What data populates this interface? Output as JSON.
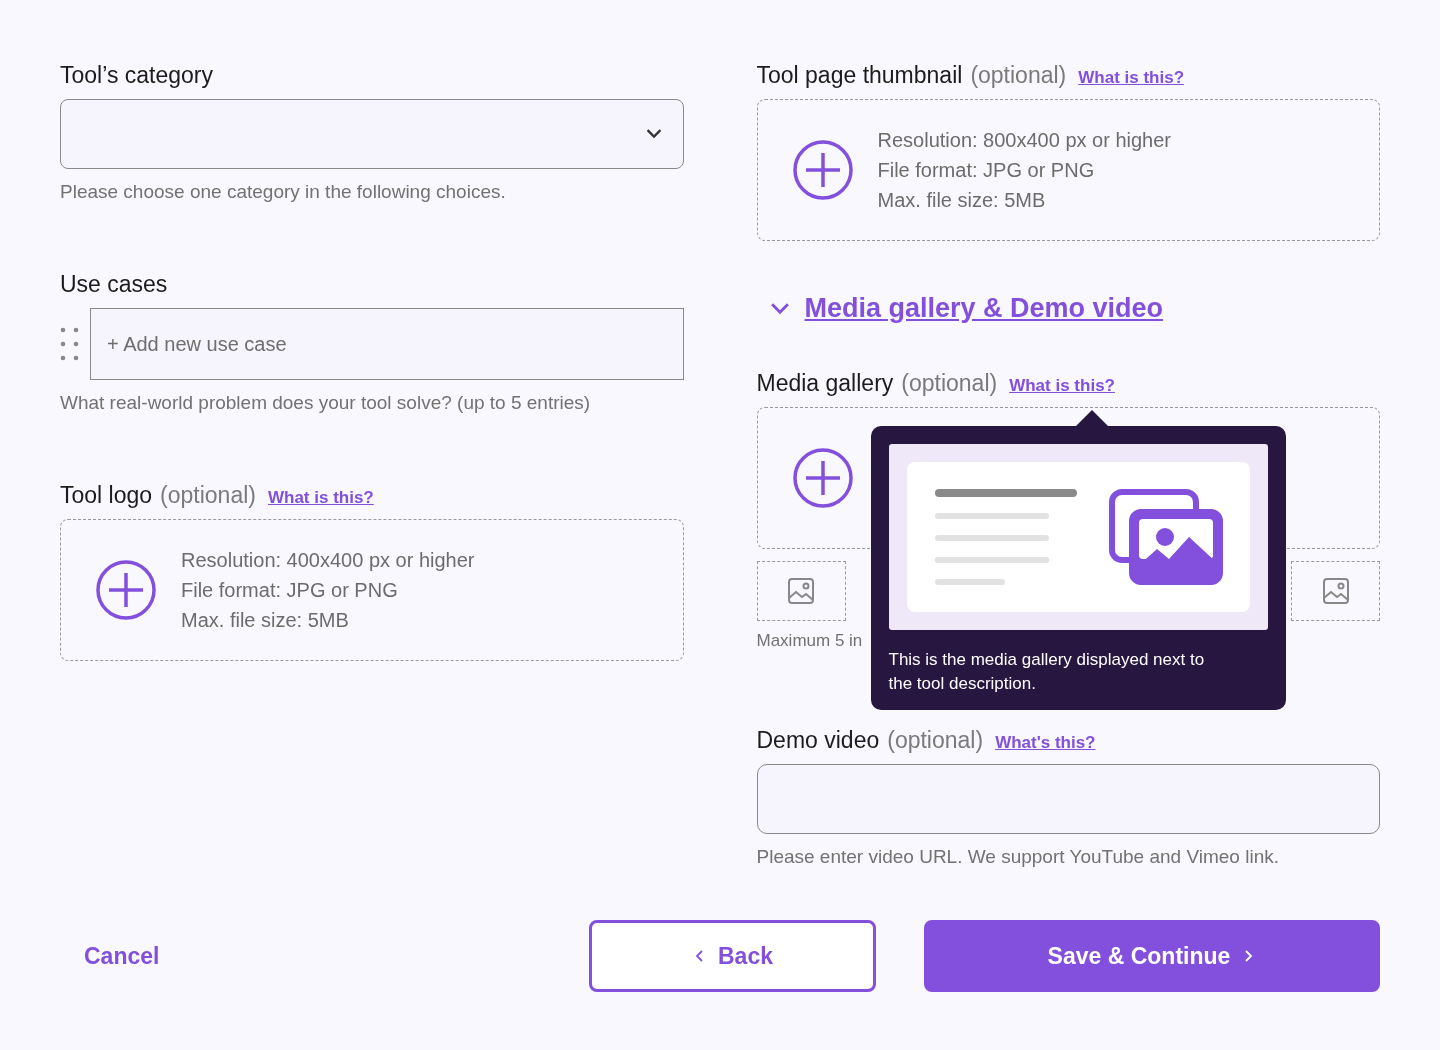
{
  "category": {
    "label": "Tool’s category",
    "help": "Please choose one category in the following choices."
  },
  "use_cases": {
    "label": "Use cases",
    "placeholder": "+ Add new use case",
    "help": "What real-world problem does your tool solve? (up to 5 entries)"
  },
  "logo": {
    "label": "Tool logo",
    "optional": "(optional)",
    "link": "What is this?",
    "requirements": [
      "Resolution: 400x400 px or higher",
      "File format: JPG or PNG",
      "Max. file size: 5MB"
    ]
  },
  "thumbnail": {
    "label": "Tool page thumbnail",
    "optional": "(optional)",
    "link": "What is this?",
    "requirements": [
      "Resolution: 800x400 px or higher",
      "File format: JPG or PNG",
      "Max. file size: 5MB"
    ]
  },
  "accordion": {
    "label": "Media gallery & Demo video",
    "expanded": true
  },
  "media_gallery": {
    "label": "Media gallery",
    "optional": "(optional)",
    "link": "What is this?",
    "slots": [
      {
        "kind": "empty"
      },
      {
        "kind": "empty"
      }
    ],
    "help": "Maximum 5 in"
  },
  "tooltip": {
    "text": "This is the media gallery displayed next to the tool description."
  },
  "demo_video": {
    "label": "Demo video",
    "optional": "(optional)",
    "link": "What's this?",
    "help": "Please enter video URL. We support YouTube and Vimeo link."
  },
  "actions": {
    "cancel": "Cancel",
    "back": "Back",
    "save": "Save & Continue"
  }
}
